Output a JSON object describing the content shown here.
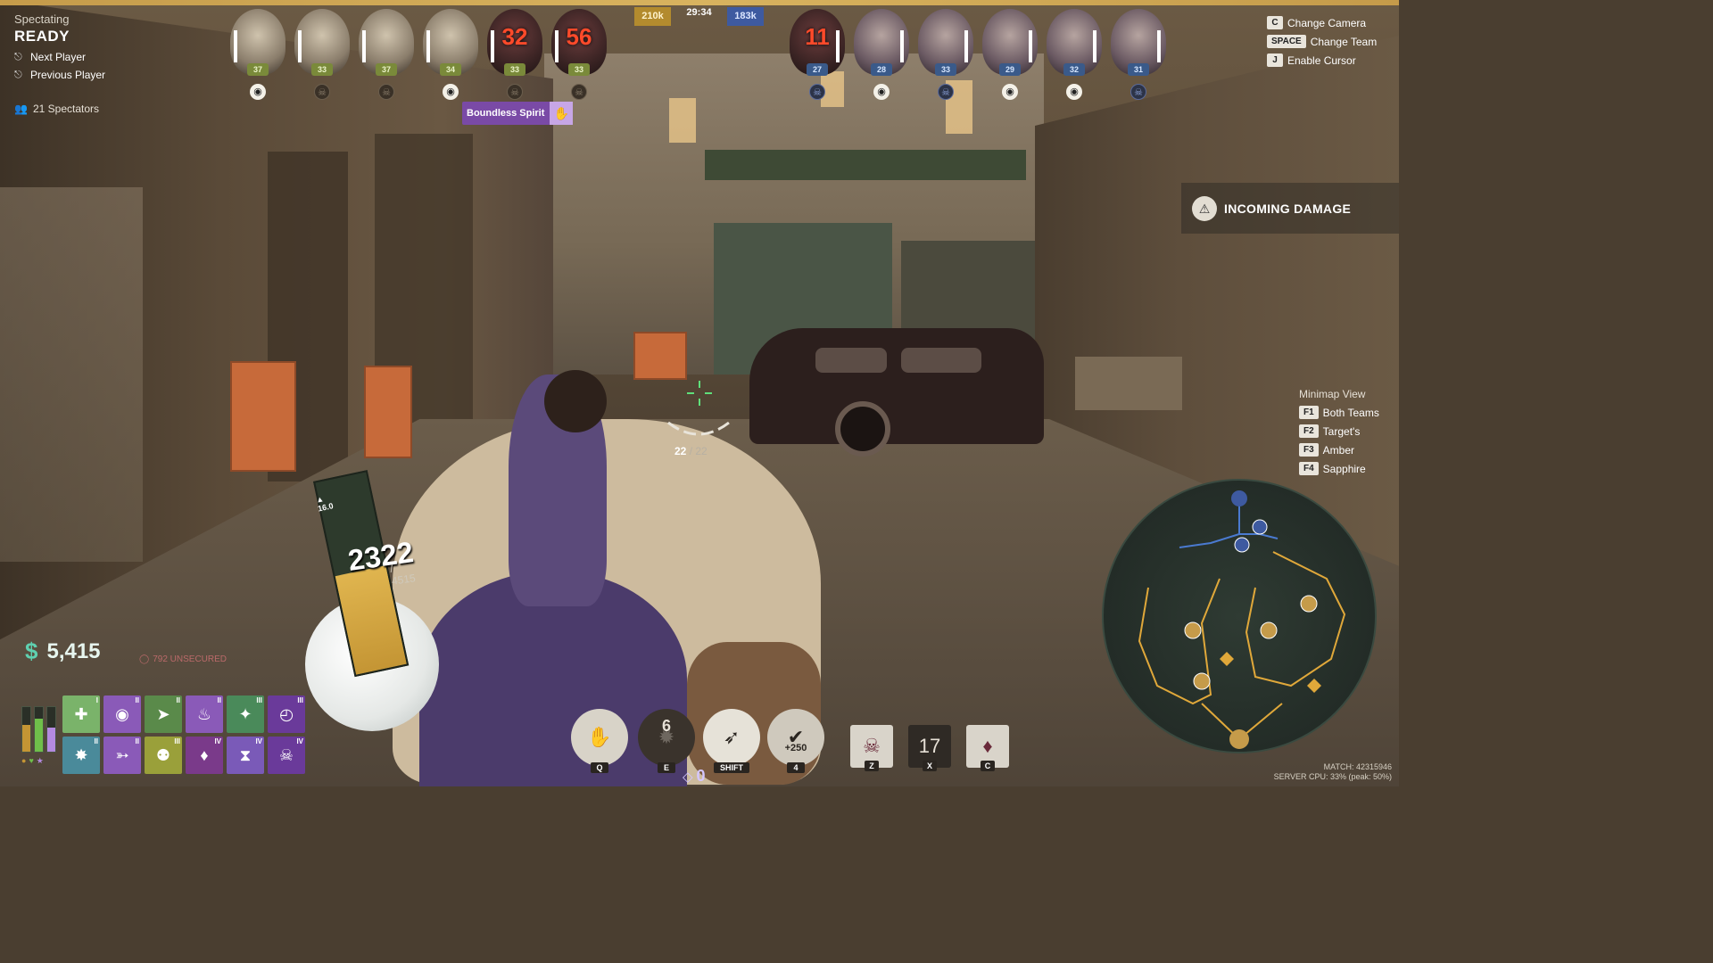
{
  "spectator": {
    "label": "Spectating",
    "status": "READY",
    "next_player": "Next Player",
    "previous_player": "Previous Player",
    "spectators_count": "21 Spectators"
  },
  "match": {
    "amber_souls": "210k",
    "sapphire_souls": "183k",
    "timer": "29:34"
  },
  "amber_team": [
    {
      "level": "37",
      "respawn": "",
      "watching": true
    },
    {
      "level": "33",
      "respawn": "",
      "watching": false
    },
    {
      "level": "37",
      "respawn": "",
      "watching": false
    },
    {
      "level": "34",
      "respawn": "",
      "watching": true
    },
    {
      "level": "33",
      "respawn": "32",
      "watching": false
    },
    {
      "level": "33",
      "respawn": "56",
      "watching": false
    }
  ],
  "sapphire_team": [
    {
      "level": "27",
      "respawn": "11",
      "watching": false
    },
    {
      "level": "28",
      "respawn": "",
      "watching": true
    },
    {
      "level": "33",
      "respawn": "",
      "watching": false
    },
    {
      "level": "29",
      "respawn": "",
      "watching": true
    },
    {
      "level": "32",
      "respawn": "",
      "watching": true
    },
    {
      "level": "31",
      "respawn": "",
      "watching": false
    }
  ],
  "buff": {
    "name": "Boundless Spirit",
    "icon": "spirit-hand-icon"
  },
  "camera_controls": [
    {
      "key": "C",
      "label": "Change Camera"
    },
    {
      "key": "SPACE",
      "label": "Change Team"
    },
    {
      "key": "J",
      "label": "Enable Cursor"
    }
  ],
  "alert": {
    "text": "INCOMING DAMAGE",
    "icon": "warning-icon"
  },
  "minimap_view": {
    "title": "Minimap View",
    "options": [
      {
        "key": "F1",
        "label": "Both Teams"
      },
      {
        "key": "F2",
        "label": "Target's"
      },
      {
        "key": "F3",
        "label": "Amber"
      },
      {
        "key": "F4",
        "label": "Sapphire"
      }
    ]
  },
  "ammo": {
    "current": "22",
    "max": "/ 22"
  },
  "health": {
    "current": "2322",
    "max": "/ 4515",
    "regen": "16.0",
    "fraction": 0.514
  },
  "souls": {
    "value": "5,415",
    "unsecured": "792 UNSECURED"
  },
  "stat_bars": [
    {
      "color": "#c49534",
      "fraction": 0.6
    },
    {
      "color": "#6fbf4a",
      "fraction": 0.75
    },
    {
      "color": "#b48ae0",
      "fraction": 0.55
    }
  ],
  "items": [
    {
      "icon": "bandage-icon",
      "color": "#7ab36a",
      "tier": "I"
    },
    {
      "icon": "bullet-icon",
      "color": "#8a5ab8",
      "tier": "II"
    },
    {
      "icon": "sprint-icon",
      "color": "#5a8a4a",
      "tier": "II"
    },
    {
      "icon": "flame-icon",
      "color": "#8a5ab8",
      "tier": "II"
    },
    {
      "icon": "rune-icon",
      "color": "#4a8a5a",
      "tier": "III"
    },
    {
      "icon": "timer-icon",
      "color": "#6a3a9a",
      "tier": "III"
    },
    {
      "icon": "star-icon",
      "color": "#4a8a9a",
      "tier": "II"
    },
    {
      "icon": "dash-icon",
      "color": "#8a5ab8",
      "tier": "II"
    },
    {
      "icon": "beast-icon",
      "color": "#9aa03a",
      "tier": "III"
    },
    {
      "icon": "crystal-icon",
      "color": "#7a3a8a",
      "tier": "IV"
    },
    {
      "icon": "hourglass-icon",
      "color": "#7a5ab8",
      "tier": "IV"
    },
    {
      "icon": "skull-icon",
      "color": "#6a3a9a",
      "tier": "IV"
    }
  ],
  "abilities": [
    {
      "key": "Q",
      "icon": "heal-hand-icon",
      "cooldown": "",
      "sub": ""
    },
    {
      "key": "E",
      "icon": "stomp-icon",
      "cooldown": "6",
      "sub": ""
    },
    {
      "key": "SHIFT",
      "icon": "leap-icon",
      "cooldown": "",
      "sub": ""
    },
    {
      "key": "4",
      "icon": "bonus-icon",
      "cooldown": "",
      "sub": "+250"
    }
  ],
  "ability_points": "0",
  "actives": [
    {
      "key": "Z",
      "icon": "skull-icon",
      "cooldown": ""
    },
    {
      "key": "X",
      "icon": "gear-icon",
      "cooldown": "17"
    },
    {
      "key": "C",
      "icon": "crystal-icon",
      "cooldown": ""
    }
  ],
  "match_info": {
    "id": "MATCH: 42315946",
    "cpu": "SERVER CPU: 33% (peak: 50%)"
  },
  "colors": {
    "amber": "#c59b4a",
    "sapphire": "#3e5aa0",
    "souls": "#5fd0b0"
  }
}
